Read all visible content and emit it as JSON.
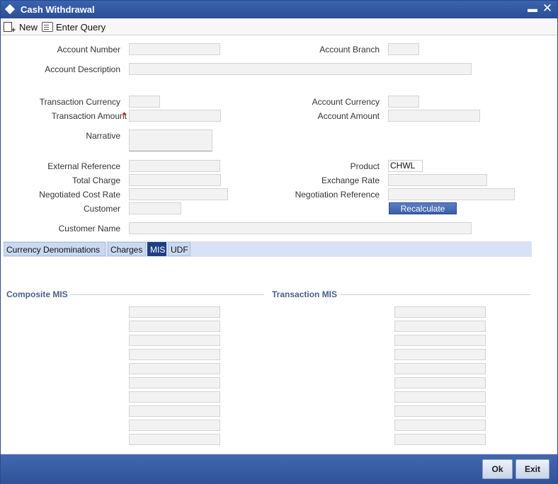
{
  "window": {
    "title": "Cash Withdrawal",
    "minimize": "▬",
    "close": "✕"
  },
  "toolbar": {
    "new_label": "New",
    "enter_query_label": "Enter Query"
  },
  "form": {
    "account_number": {
      "label": "Account Number",
      "value": ""
    },
    "account_branch": {
      "label": "Account Branch",
      "value": ""
    },
    "account_description": {
      "label": "Account Description",
      "value": ""
    },
    "transaction_currency": {
      "label": "Transaction Currency",
      "value": ""
    },
    "account_currency": {
      "label": "Account Currency",
      "value": ""
    },
    "transaction_amount": {
      "label": "Transaction Amount",
      "required_mark": "*",
      "value": ""
    },
    "account_amount": {
      "label": "Account Amount",
      "value": ""
    },
    "narrative": {
      "label": "Narrative",
      "value": ""
    },
    "external_reference": {
      "label": "External Reference",
      "value": ""
    },
    "product": {
      "label": "Product",
      "value": "CHWL"
    },
    "total_charge": {
      "label": "Total Charge",
      "value": ""
    },
    "exchange_rate": {
      "label": "Exchange Rate",
      "value": ""
    },
    "negotiated_cost_rate": {
      "label": "Negotiated Cost Rate",
      "value": ""
    },
    "negotiation_reference": {
      "label": "Negotiation Reference",
      "value": ""
    },
    "customer": {
      "label": "Customer",
      "value": ""
    },
    "recalculate_label": "Recalculate",
    "customer_name": {
      "label": "Customer Name",
      "value": ""
    }
  },
  "tabs": [
    {
      "label": "Currency Denominations",
      "active": false
    },
    {
      "label": "Charges",
      "active": false
    },
    {
      "label": "MIS",
      "active": true
    },
    {
      "label": "UDF",
      "active": false
    }
  ],
  "mis": {
    "composite_title": "Composite MIS",
    "transaction_title": "Transaction MIS",
    "composite_fields": [
      "",
      "",
      "",
      "",
      "",
      "",
      "",
      "",
      "",
      ""
    ],
    "transaction_fields": [
      "",
      "",
      "",
      "",
      "",
      "",
      "",
      "",
      "",
      ""
    ]
  },
  "footer": {
    "ok_label": "Ok",
    "exit_label": "Exit"
  }
}
